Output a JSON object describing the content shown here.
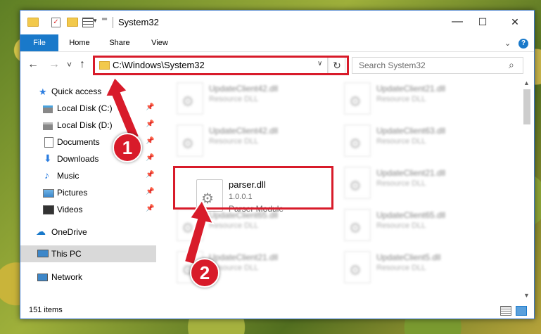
{
  "window": {
    "title": "System32",
    "controls": {
      "minimize": "—",
      "maximize": "☐",
      "close": "✕"
    }
  },
  "ribbon": {
    "tabs": [
      "File",
      "Home",
      "Share",
      "View"
    ],
    "expand": "⌄",
    "help": "?"
  },
  "navigation": {
    "back": "←",
    "forward": "→",
    "recent": "˅",
    "up": "↑",
    "address": "C:\\Windows\\System32",
    "address_dropdown": "∨",
    "refresh": "↻",
    "search_placeholder": "Search System32",
    "search_icon": "⌕"
  },
  "sidebar": {
    "items": [
      {
        "label": "Quick access",
        "icon": "star-icon",
        "pinned": false
      },
      {
        "label": "Local Disk (C:)",
        "icon": "drive-icon",
        "pinned": true
      },
      {
        "label": "Local Disk (D:)",
        "icon": "drive-icon",
        "pinned": true
      },
      {
        "label": "Documents",
        "icon": "documents-icon",
        "pinned": true
      },
      {
        "label": "Downloads",
        "icon": "download-icon",
        "pinned": true
      },
      {
        "label": "Music",
        "icon": "music-icon",
        "pinned": true
      },
      {
        "label": "Pictures",
        "icon": "pictures-icon",
        "pinned": true
      },
      {
        "label": "Videos",
        "icon": "videos-icon",
        "pinned": true
      },
      {
        "label": "OneDrive",
        "icon": "cloud-icon",
        "pinned": false
      },
      {
        "label": "This PC",
        "icon": "computer-icon",
        "pinned": false
      },
      {
        "label": "Network",
        "icon": "network-icon",
        "pinned": false
      }
    ],
    "pin_glyph": "📌"
  },
  "files": [
    {
      "name": "UpdateClient42.dll",
      "line1": "Resource DLL"
    },
    {
      "name": "UpdateClient21.dll",
      "line1": "Resource DLL"
    },
    {
      "name": "UpdateClient42.dll",
      "line1": "Resource DLL"
    },
    {
      "name": "UpdateClient63.dll",
      "line1": "Resource DLL"
    },
    {
      "name": "parser.dll",
      "line1": "1.0.0.1",
      "line2": "Parser Module"
    },
    {
      "name": "UpdateClient21.dll",
      "line1": "Resource DLL"
    },
    {
      "name": "UpdateClient65.dll",
      "line1": "Resource DLL"
    },
    {
      "name": "UpdateClient65.dll",
      "line1": "Resource DLL"
    },
    {
      "name": "UpdateClient21.dll",
      "line1": "Resource DLL"
    },
    {
      "name": "UpdateClient5.dll",
      "line1": "Resource DLL"
    }
  ],
  "status": {
    "item_count": "151 items"
  },
  "annotations": {
    "step1": "1",
    "step2": "2"
  },
  "colors": {
    "accent": "#1979ca",
    "highlight": "#d81b2a"
  }
}
